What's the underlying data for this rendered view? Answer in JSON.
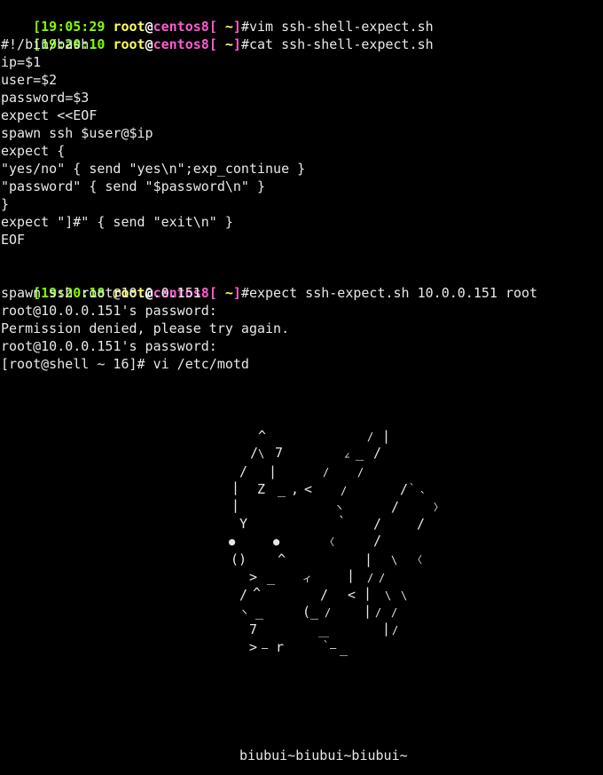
{
  "prompts": [
    {
      "open": "[",
      "time": "19:05:29",
      "user": "root",
      "at": "@",
      "host": "centos8",
      "bracket_close": "[",
      "dir": " ~",
      "close": "]",
      "symbol": "#",
      "command": "vim ssh-shell-expect.sh"
    },
    {
      "open": "[",
      "time": "19:20:10",
      "user": "root",
      "at": "@",
      "host": "centos8",
      "bracket_close": "[",
      "dir": " ~",
      "close": "]",
      "symbol": "#",
      "command": "cat ssh-shell-expect.sh"
    },
    {
      "open": "[",
      "time": "19:20:18",
      "user": "root",
      "at": "@",
      "host": "centos8",
      "bracket_close": "[",
      "dir": " ~",
      "close": "]",
      "symbol": "#",
      "command": "expect ssh-expect.sh 10.0.0.151 root"
    }
  ],
  "script_lines": [
    "#!/bin/bash",
    "ip=$1",
    "user=$2",
    "password=$3",
    "expect <<EOF",
    "spawn ssh $user@$ip",
    "expect {",
    "\"yes/no\" { send \"yes\\n\";exp_continue }",
    "\"password\" { send \"$password\\n\" }",
    "}",
    "expect \"]#\" { send \"exit\\n\" }",
    "EOF"
  ],
  "output_lines": [
    "spawn ssh root@10.0.0.151",
    "root@10.0.0.151's password:",
    "Permission denied, please try again.",
    "root@10.0.0.151's password:",
    "[root@shell ~ 16]# vi /etc/motd"
  ],
  "ascii_art": [
    "^",
    "/",
    "|",
    "/",
    "\\",
    "7",
    "∠",
    "_",
    "/",
    "/",
    "|",
    "/",
    "/",
    "|",
    "Z",
    "_",
    ",",
    "<",
    "/",
    "/",
    "`",
    "、",
    "|",
    "ヽ",
    "/",
    "〉",
    "Y",
    "`",
    "/",
    "/",
    "●",
    "●",
    "〈",
    "/",
    "()",
    "^",
    "|",
    "\\",
    "〈",
    ">",
    "_",
    "ィ",
    "|",
    "/",
    "/",
    "/",
    "^",
    "/",
    "<",
    "|",
    "\\",
    "\\",
    "ヽ",
    "_",
    "(_",
    "/",
    "|",
    "/",
    "/",
    "7",
    "|",
    "/",
    ">",
    "―",
    "r",
    "￣",
    "`",
    "―",
    "_"
  ],
  "motd_caption": "biubui~biubui~biubui~",
  "colors": {
    "background": "#000000",
    "text": "#e8e8e8",
    "time": "#7fff00",
    "user": "#ffff55",
    "host": "#ff5ad2"
  }
}
